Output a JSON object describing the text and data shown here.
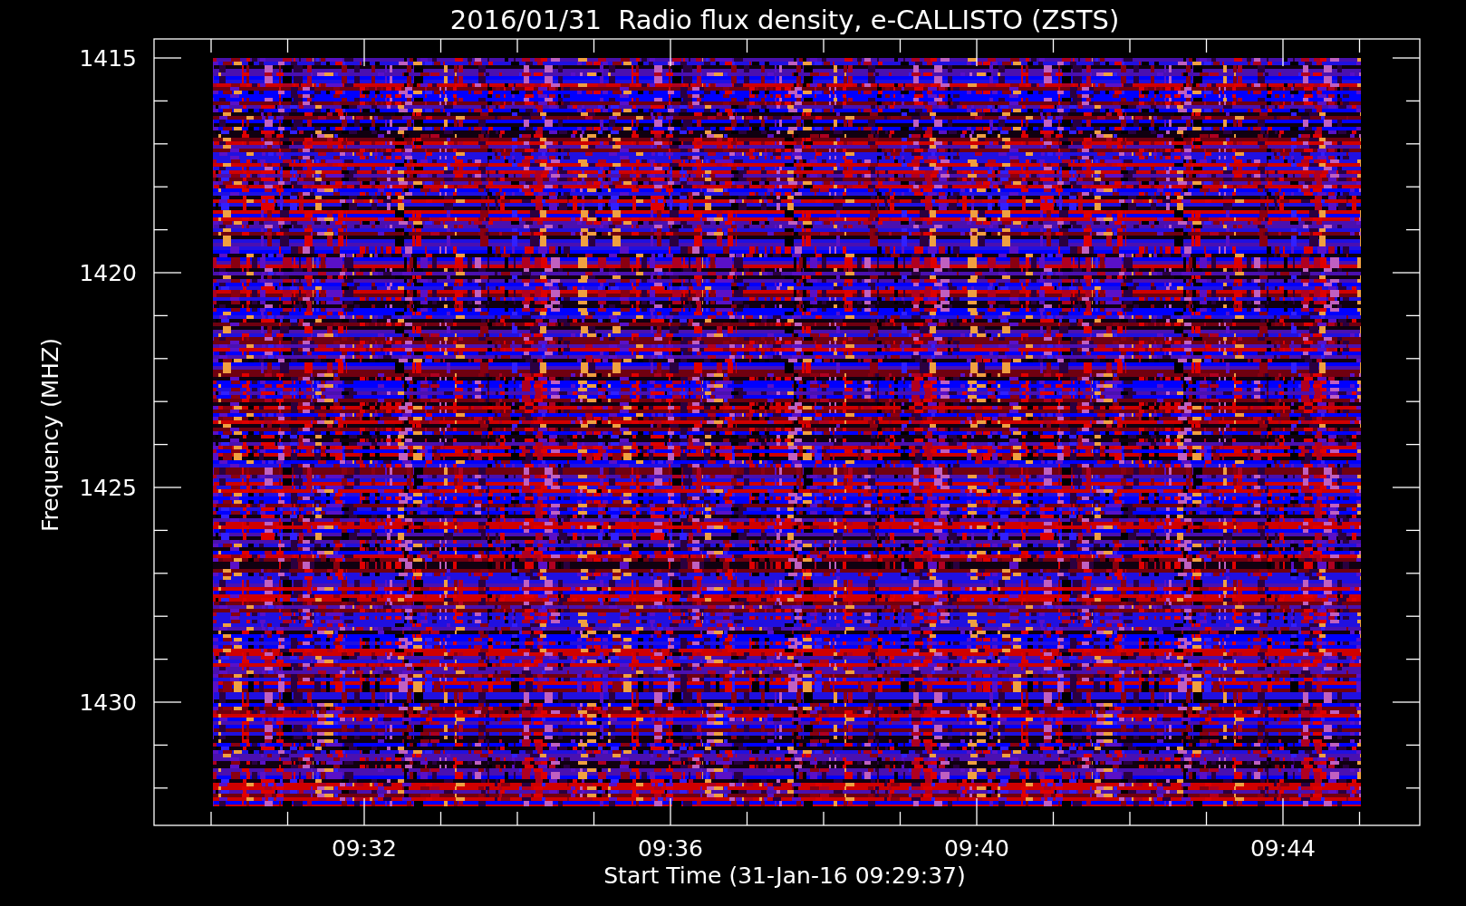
{
  "title": "2016/01/31  Radio flux density, e-CALLISTO (ZSTS)",
  "ylabel": "Frequency (MHZ)",
  "xlabel": "Start Time (31-Jan-16 09:29:37)",
  "yticks": [
    "1415",
    "1420",
    "1425",
    "1430"
  ],
  "xticks": [
    "09:32",
    "09:36",
    "09:40",
    "09:44"
  ]
}
